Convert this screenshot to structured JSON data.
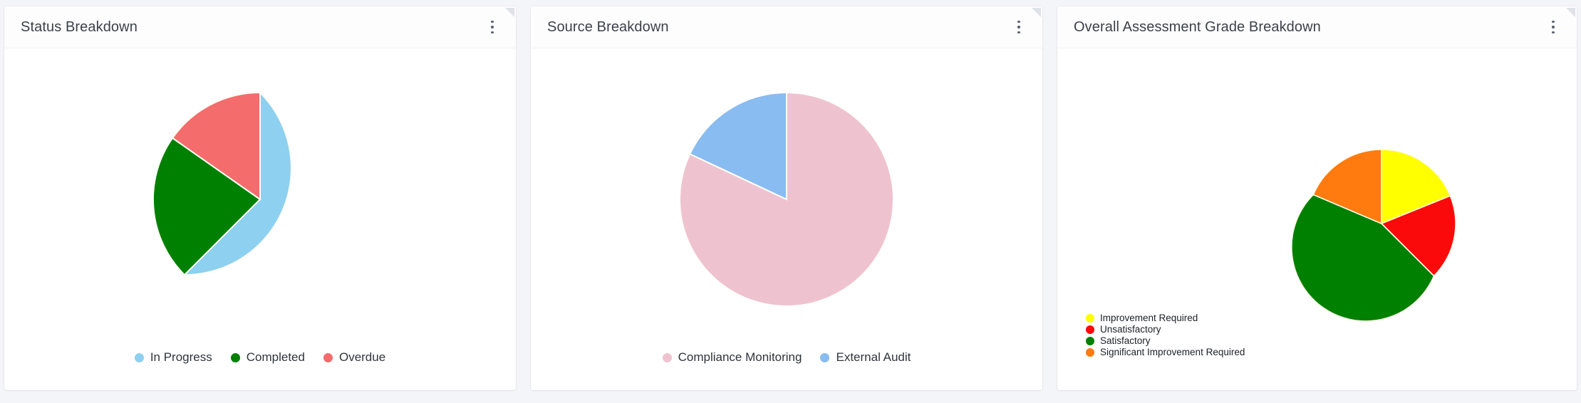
{
  "panels": [
    {
      "title": "Status Breakdown",
      "menu_icon": "kebab-menu-icon",
      "legend_orientation": "horizontal"
    },
    {
      "title": "Source Breakdown",
      "menu_icon": "kebab-menu-icon",
      "legend_orientation": "horizontal"
    },
    {
      "title": "Overall Assessment Grade Breakdown",
      "menu_icon": "kebab-menu-icon",
      "legend_orientation": "vertical"
    }
  ],
  "chart_data": [
    {
      "type": "pie",
      "title": "Status Breakdown",
      "categories": [
        "In Progress",
        "Completed",
        "Overdue"
      ],
      "values": [
        62.5,
        22.2,
        15.3
      ],
      "colors": [
        "#8ed0f0",
        "#008000",
        "#f46c6c"
      ],
      "start_angle": 0,
      "direction": "clockwise",
      "legend_position": "bottom",
      "legend_orientation": "horizontal"
    },
    {
      "type": "pie",
      "title": "Source Breakdown",
      "categories": [
        "Compliance Monitoring",
        "External Audit"
      ],
      "values": [
        82.0,
        18.0
      ],
      "colors": [
        "#eec3cf",
        "#89bcf0"
      ],
      "start_angle": 0,
      "direction": "clockwise",
      "legend_position": "bottom",
      "legend_orientation": "horizontal"
    },
    {
      "type": "pie",
      "title": "Overall Assessment Grade Breakdown",
      "categories": [
        "Improvement Required",
        "Unsatisfactory",
        "Satisfactory",
        "Significant Improvement Required"
      ],
      "values": [
        18.9,
        18.6,
        43.9,
        18.6
      ],
      "colors": [
        "#ffff00",
        "#fa0a0a",
        "#008000",
        "#ff7a0f"
      ],
      "start_angle": 0,
      "direction": "clockwise",
      "legend_position": "left",
      "legend_orientation": "vertical"
    }
  ]
}
